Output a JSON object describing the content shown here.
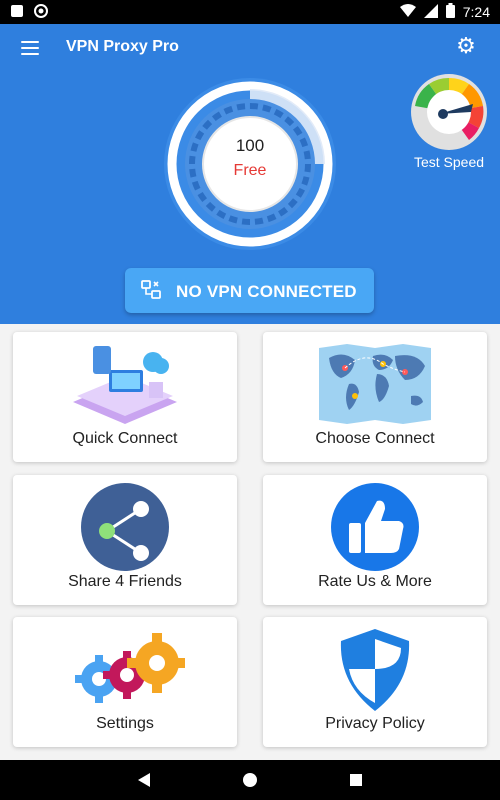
{
  "status_bar": {
    "time": "7:24"
  },
  "header": {
    "title": "VPN Proxy Pro"
  },
  "dial": {
    "value": "100",
    "label": "Free"
  },
  "test_speed": {
    "label": "Test Speed"
  },
  "vpn_status": {
    "label": "NO VPN CONNECTED"
  },
  "cards": [
    {
      "label": "Quick Connect"
    },
    {
      "label": "Choose Connect"
    },
    {
      "label": "Share 4 Friends"
    },
    {
      "label": "Rate Us & More"
    },
    {
      "label": "Settings"
    },
    {
      "label": "Privacy Policy"
    }
  ],
  "colors": {
    "primary": "#2f7fde",
    "accent": "#49a7f5",
    "free_text": "#e53935"
  }
}
